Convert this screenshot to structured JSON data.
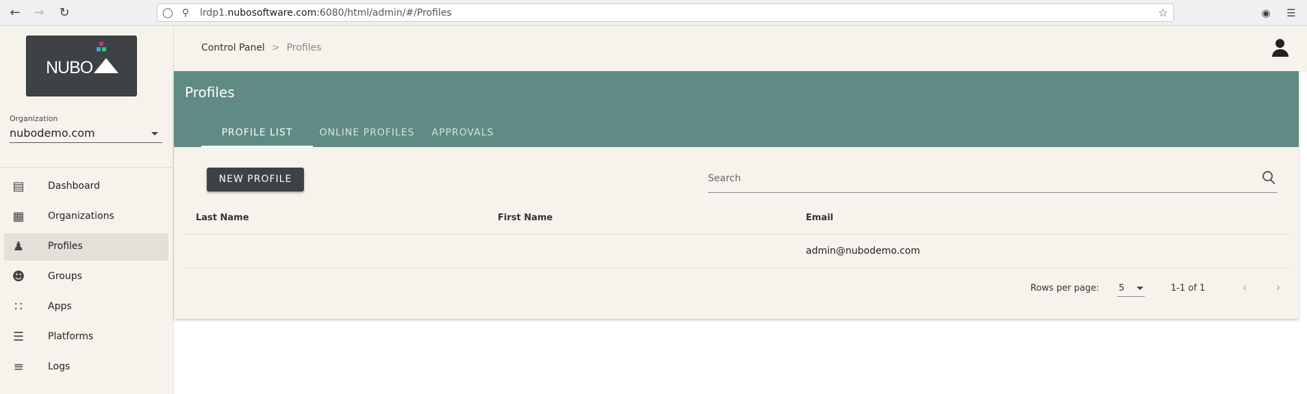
{
  "browser": {
    "url_prefix": "lrdp1.",
    "url_domain": "nubosoftware.com",
    "url_suffix": ":6080/html/admin/#/Profiles"
  },
  "sidebar": {
    "logo_text": "NUBO",
    "org_label": "Organization",
    "org_value": "nubodemo.com",
    "items": [
      {
        "label": "Dashboard",
        "icon": "bar-chart-icon"
      },
      {
        "label": "Organizations",
        "icon": "building-icon"
      },
      {
        "label": "Profiles",
        "icon": "people-icon"
      },
      {
        "label": "Groups",
        "icon": "groups-icon"
      },
      {
        "label": "Apps",
        "icon": "apps-grid-icon"
      },
      {
        "label": "Platforms",
        "icon": "storage-icon"
      },
      {
        "label": "Logs",
        "icon": "checklist-icon"
      }
    ]
  },
  "breadcrumb": {
    "root": "Control Panel",
    "separator": ">",
    "current": "Profiles"
  },
  "card": {
    "title": "Profiles",
    "tabs": [
      "PROFILE LIST",
      "ONLINE PROFILES",
      "APPROVALS"
    ],
    "new_button": "NEW PROFILE",
    "search_placeholder": "Search"
  },
  "table": {
    "columns": [
      "Last Name",
      "First Name",
      "Email"
    ],
    "rows": [
      {
        "last_name": "",
        "first_name": "",
        "email": "admin@nubodemo.com"
      }
    ]
  },
  "pagination": {
    "rows_per_page_label": "Rows per page:",
    "rows_per_page": "5",
    "range": "1-1 of 1"
  },
  "colors": {
    "header_teal": "#608b85",
    "sidebar_bg": "#f6f3ec",
    "button_dark": "#3e4245"
  }
}
